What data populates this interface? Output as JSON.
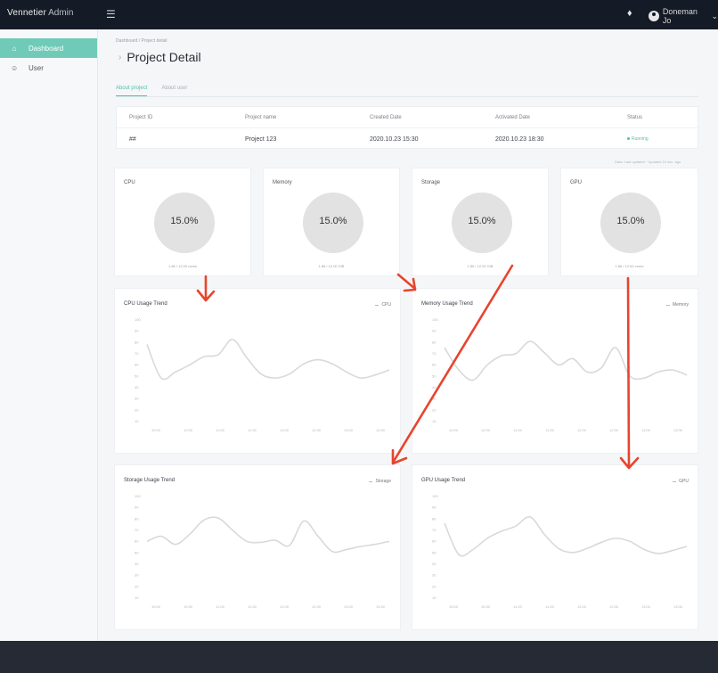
{
  "header": {
    "brand": "Vennetier",
    "brand_suffix": "Admin",
    "user_name": "Doneman Jo"
  },
  "sidebar": {
    "items": [
      {
        "label": "Dashboard",
        "icon": "home-icon",
        "active": true
      },
      {
        "label": "User",
        "icon": "user-icon",
        "active": false
      }
    ]
  },
  "page": {
    "breadcrumb": "Dashboard / Project detail",
    "title": "Project Detail",
    "tabs": [
      {
        "label": "About project",
        "active": true
      },
      {
        "label": "About user",
        "active": false
      }
    ]
  },
  "project_table": {
    "headers": [
      "Project ID",
      "Project name",
      "Created Date",
      "Activated Date",
      "Status"
    ],
    "row": [
      "##",
      "Project 123",
      "2020.10.23 15:30",
      "2020.10.23 18:30",
      "Running"
    ]
  },
  "meta_text": "Data: Last updated · Updated 10 sec. ago",
  "resources": [
    {
      "name": "CPU",
      "value": "15.0%",
      "sub": "1.86 / 12.00 cores"
    },
    {
      "name": "Memory",
      "value": "15.0%",
      "sub": "1.86 / 12.00 GiB"
    },
    {
      "name": "Storage",
      "value": "15.0%",
      "sub": "1.86 / 12.00 GiB"
    },
    {
      "name": "GPU",
      "value": "15.0%",
      "sub": "1.86 / 12.00 cores"
    }
  ],
  "colors": {
    "accent": "#6fcbb7",
    "arrow": "#e8442e",
    "line": "#d9d9d9"
  },
  "chart_data": [
    {
      "type": "line",
      "title": "CPU Usage Trend",
      "series": [
        {
          "name": "CPU",
          "values": [
            75,
            42,
            48,
            55,
            63,
            65,
            80,
            62,
            46,
            42,
            46,
            56,
            60,
            56,
            48,
            42,
            45,
            50
          ]
        }
      ],
      "ylim": [
        0,
        100
      ],
      "y_ticks": [
        "100",
        "90",
        "80",
        "70",
        "60",
        "50",
        "40",
        "30",
        "20",
        "10"
      ],
      "x_ticks": [
        "10:00",
        "10:30",
        "11:00",
        "11:30",
        "12:00",
        "12:30",
        "13:00",
        "13:30"
      ]
    },
    {
      "type": "line",
      "title": "Memory Usage Trend",
      "series": [
        {
          "name": "Memory",
          "values": [
            72,
            50,
            40,
            55,
            64,
            66,
            78,
            67,
            55,
            61,
            48,
            52,
            72,
            44,
            42,
            48,
            50,
            45
          ]
        }
      ],
      "ylim": [
        0,
        100
      ],
      "y_ticks": [
        "100",
        "90",
        "80",
        "70",
        "60",
        "50",
        "40",
        "30",
        "20",
        "10"
      ],
      "x_ticks": [
        "10:00",
        "10:30",
        "11:00",
        "11:30",
        "12:00",
        "12:30",
        "13:00",
        "13:30"
      ]
    },
    {
      "type": "line",
      "title": "Storage Usage Trend",
      "series": [
        {
          "name": "Storage",
          "values": [
            55,
            60,
            52,
            62,
            76,
            78,
            66,
            55,
            54,
            56,
            51,
            75,
            60,
            45,
            47,
            50,
            52,
            55
          ]
        }
      ],
      "ylim": [
        0,
        100
      ],
      "y_ticks": [
        "100",
        "90",
        "80",
        "70",
        "60",
        "50",
        "40",
        "30",
        "20",
        "10"
      ],
      "x_ticks": [
        "10:00",
        "10:30",
        "11:00",
        "11:30",
        "12:00",
        "12:30",
        "13:00",
        "13:30"
      ]
    },
    {
      "type": "line",
      "title": "GPU Usage Trend",
      "series": [
        {
          "name": "GPU",
          "values": [
            73,
            42,
            47,
            58,
            65,
            70,
            79,
            62,
            48,
            44,
            48,
            54,
            58,
            55,
            47,
            43,
            46,
            50
          ]
        }
      ],
      "ylim": [
        0,
        100
      ],
      "y_ticks": [
        "100",
        "90",
        "80",
        "70",
        "60",
        "50",
        "40",
        "30",
        "20",
        "10"
      ],
      "x_ticks": [
        "10:00",
        "10:30",
        "11:00",
        "11:30",
        "12:00",
        "12:30",
        "13:00",
        "13:30"
      ]
    }
  ]
}
